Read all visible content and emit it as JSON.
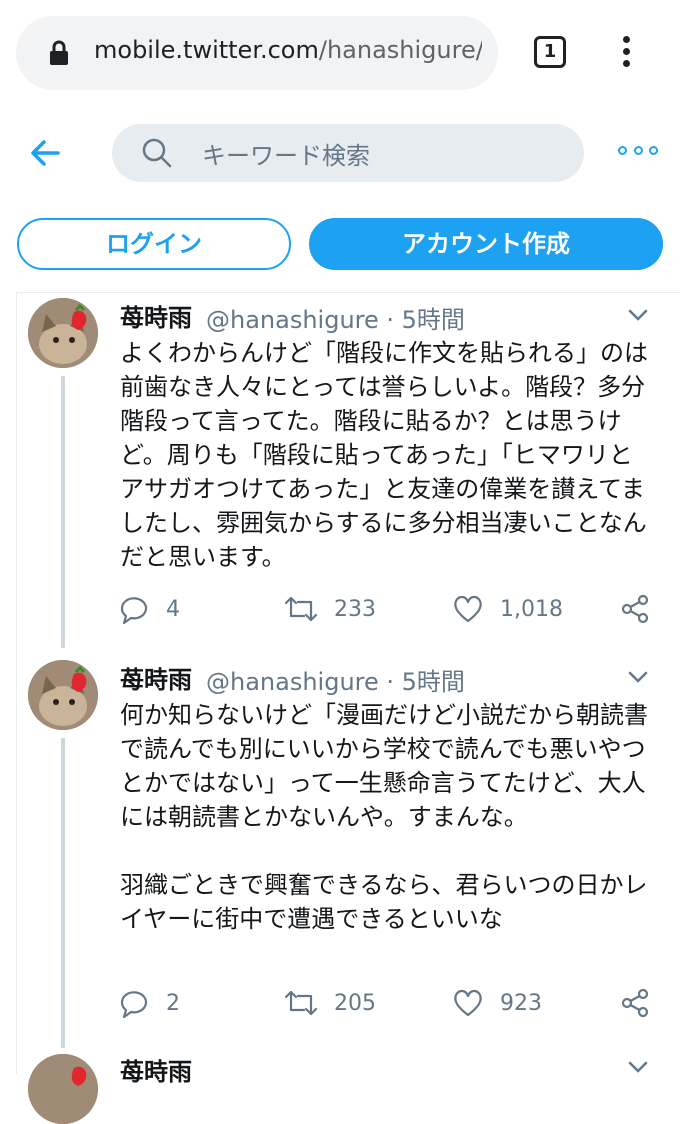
{
  "browser": {
    "url_host": "mobile.twitter.com",
    "url_path": "/hanashigure/s",
    "tab_count": "1"
  },
  "nav": {
    "search_placeholder": "キーワード検索",
    "login_label": "ログイン",
    "signup_label": "アカウント作成"
  },
  "tweets": [
    {
      "name": "苺時雨",
      "handle": "@hanashigure · 5時間",
      "text": "よくわからんけど「階段に作文を貼られる」のは前歯なき人々にとっては誉らしいよ。階段？多分階段って言ってた。階段に貼るか？とは思うけど。周りも「階段に貼ってあった」「ヒマワリとアサガオつけてあった」と友達の偉業を讃えてましたし、雰囲気からするに多分相当凄いことなんだと思います。",
      "replies": "4",
      "retweets": "233",
      "likes": "1,018"
    },
    {
      "name": "苺時雨",
      "handle": "@hanashigure · 5時間",
      "text": "何か知らないけど「漫画だけど小説だから朝読書で読んでも別にいいから学校で読んでも悪いやつとかではない」って一生懸命言うてたけど、大人には朝読書とかないんや。すまんな。\n\n羽織ごときで興奮できるなら、君らいつの日かレイヤーに街中で遭遇できるといいな",
      "replies": "2",
      "retweets": "205",
      "likes": "923"
    },
    {
      "name": "苺時雨"
    }
  ],
  "colors": {
    "accent": "#1da1f2",
    "secondary_text": "#657786"
  }
}
